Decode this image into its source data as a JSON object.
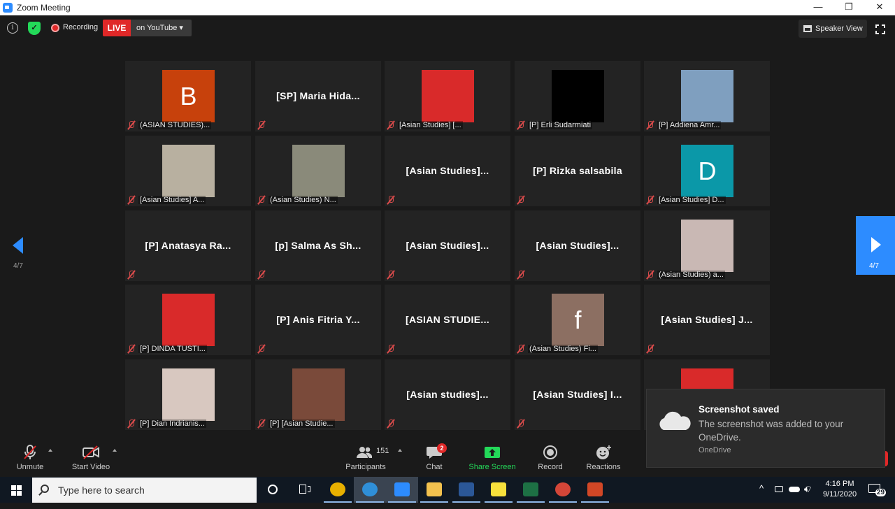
{
  "window": {
    "title": "Zoom Meeting",
    "controls": [
      "—",
      "❐",
      "✕"
    ]
  },
  "topbar": {
    "recording_label": "Recording",
    "live_label": "LIVE",
    "stream_label": "on YouTube ▾",
    "speaker_view_label": "Speaker View",
    "colors": {
      "live": "#e02828",
      "shield": "#23d959"
    }
  },
  "pagination": {
    "left_label": "4/7",
    "right_label": "4/7",
    "accent": "#2d8cff"
  },
  "tiles": [
    {
      "type": "avatar",
      "letter": "B",
      "color": "#c7410c",
      "name": "(ASIAN STUDIES)..."
    },
    {
      "type": "name",
      "big_name": "[SP]  Maria  Hida..."
    },
    {
      "type": "photo",
      "color": "#d92a2a",
      "name": "[Asian Studies] [..."
    },
    {
      "type": "photo",
      "color": "#000000",
      "name": "[P] Erli Sudarmiati"
    },
    {
      "type": "photo",
      "color": "#7f9fbf",
      "name": "[P] Addiena Amr..."
    },
    {
      "type": "photo",
      "color": "#b8b0a0",
      "name": "[Asian Studies] A..."
    },
    {
      "type": "photo",
      "color": "#8a8a7a",
      "name": "(Asian Studies) N..."
    },
    {
      "type": "name",
      "big_name": "[Asian Studies]..."
    },
    {
      "type": "name",
      "big_name": "[P] Rizka salsabila"
    },
    {
      "type": "avatar",
      "letter": "D",
      "color": "#0b98a8",
      "name": "[Asian Studies] D..."
    },
    {
      "type": "name",
      "big_name": "[P] Anatasya Ra..."
    },
    {
      "type": "name",
      "big_name": "[p] Salma As Sh..."
    },
    {
      "type": "name",
      "big_name": "[Asian Studies]..."
    },
    {
      "type": "name",
      "big_name": "[Asian Studies]..."
    },
    {
      "type": "photo",
      "color": "#c9b8b4",
      "name": "(Asian Studies) a..."
    },
    {
      "type": "photo",
      "color": "#d92a2a",
      "name": "[P] DINDA TUSTI..."
    },
    {
      "type": "name",
      "big_name": "[P] Anis Fitria Y..."
    },
    {
      "type": "name",
      "big_name": "[ASIAN STUDIE..."
    },
    {
      "type": "avatar",
      "letter": "f",
      "color": "#8c6f62",
      "name": "(Asian Studies) Fi..."
    },
    {
      "type": "name",
      "big_name": "[Asian Studies] J..."
    },
    {
      "type": "photo",
      "color": "#d8c8c0",
      "name": "[P] Dian Indrianis..."
    },
    {
      "type": "photo",
      "color": "#7a4a3a",
      "name": "[P] [Asian Studie..."
    },
    {
      "type": "name",
      "big_name": "[Asian studies]..."
    },
    {
      "type": "name",
      "big_name": "[Asian Studies] I..."
    },
    {
      "type": "photo",
      "color": "#d92a2a",
      "name": ""
    }
  ],
  "toolbar": {
    "unmute": "Unmute",
    "start_video": "Start Video",
    "participants_count": "151",
    "participants": "Participants",
    "chat": "Chat",
    "chat_badge": "2",
    "share_screen": "Share Screen",
    "record": "Record",
    "reactions": "Reactions",
    "share_color": "#23d959"
  },
  "toast": {
    "title": "Screenshot saved",
    "body": "The screenshot was added to your OneDrive.",
    "source": "OneDrive"
  },
  "taskbar": {
    "search_placeholder": "Type here to search",
    "time": "4:16 PM",
    "date": "9/11/2020",
    "notifications": "29",
    "apps": [
      {
        "name": "chrome",
        "color": "#e8b000"
      },
      {
        "name": "edge",
        "color": "#2f8fd8"
      },
      {
        "name": "zoom",
        "color": "#2d8cff"
      },
      {
        "name": "file-explorer",
        "color": "#f2c14e"
      },
      {
        "name": "word",
        "color": "#2b5797"
      },
      {
        "name": "sticky-notes",
        "color": "#f7e03c"
      },
      {
        "name": "excel",
        "color": "#1d7044"
      },
      {
        "name": "chrome-2",
        "color": "#d44638"
      },
      {
        "name": "powerpoint",
        "color": "#d24726"
      }
    ]
  }
}
